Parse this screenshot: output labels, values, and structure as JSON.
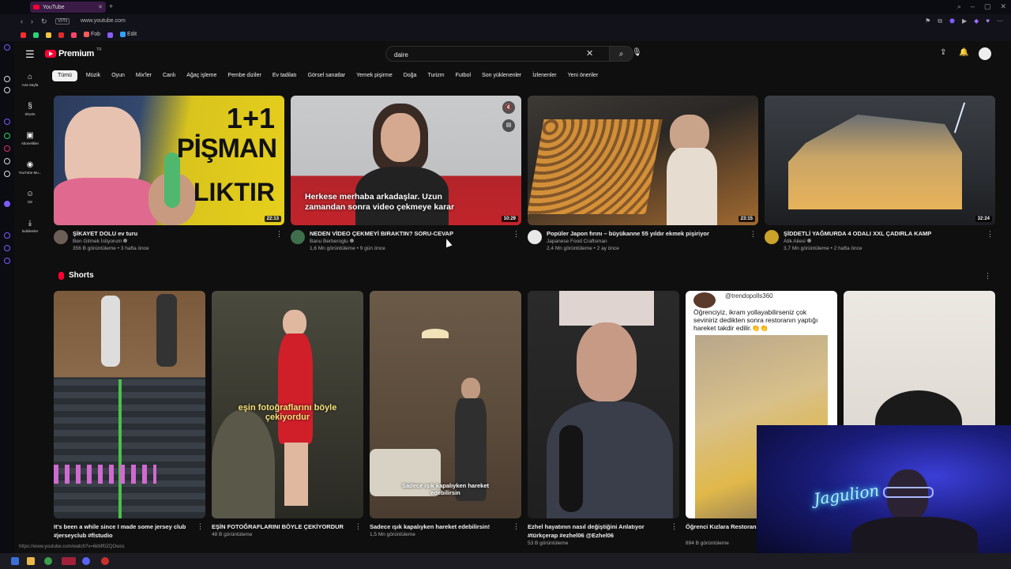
{
  "browser": {
    "tab_title": "YouTube",
    "url": "www.youtube.com",
    "vpn_label": "VPN",
    "bookmarks": [
      {
        "label": "Fob",
        "color": "#ff5a5a"
      },
      {
        "label": "Edit",
        "color": "#33a1ff"
      }
    ]
  },
  "header": {
    "logo_text": "Premium",
    "logo_region": "TR",
    "search_value": "daire"
  },
  "chips": [
    "Tümü",
    "Müzik",
    "Oyun",
    "Mix'ler",
    "Canlı",
    "Ağaç işleme",
    "Pembe diziler",
    "Ev tadilatı",
    "Görsel sanatlar",
    "Yemek pişirme",
    "Doğa",
    "Turizm",
    "Futbol",
    "Son yüklenenler",
    "İzlenenler",
    "Yeni öneriler"
  ],
  "guide": [
    {
      "label": "Ana Sayfa",
      "icon": "home-icon"
    },
    {
      "label": "Shorts",
      "icon": "shorts-icon"
    },
    {
      "label": "Abonelikler",
      "icon": "subscriptions-icon"
    },
    {
      "label": "YouTube Mu...",
      "icon": "youtube-music-icon"
    },
    {
      "label": "Siz",
      "icon": "you-icon"
    },
    {
      "label": "İndirilenler",
      "icon": "download-icon"
    }
  ],
  "videos": [
    {
      "title": "ŞİKAYET DOLU ev turu",
      "channel": "Ben Gitmek İstiyorum",
      "stats": "356 B görüntüleme • 3 hafta önce",
      "duration": "22:13",
      "thumb_text_a": "1+1",
      "thumb_text_b": "PİŞMAN",
      "thumb_text_c": "LIKTIR"
    },
    {
      "title": "NEDEN VİDEO ÇEKMEYİ BIRAKTIN? SORU-CEVAP",
      "channel": "Banu Berberoglu",
      "stats": "1,6 Mn görüntüleme • 9 gün önce",
      "duration": "10:29",
      "caption": "Herkese merhaba arkadaşlar. Uzun zamandan sonra video çekmeye karar"
    },
    {
      "title": "Popüler Japon fırını – büyükanne 55 yıldır ekmek pişiriyor",
      "channel": "Japanese Food Craftsman",
      "stats": "2,4 Mn görüntüleme • 2 ay önce",
      "duration": "23:15"
    },
    {
      "title": "ŞİDDETLİ YAĞMURDA 4 ODALI XXL ÇADIRLA KAMP",
      "channel": "Atik Ailesi",
      "stats": "3,7 Mn görüntüleme • 2 hafta önce",
      "duration": "32:24"
    }
  ],
  "shorts": {
    "section_title": "Shorts",
    "items": [
      {
        "title": "It's been a while since I made some jersey club #jerseyclub #flstudio",
        "views": ""
      },
      {
        "title": "EŞİN FOTOĞRAFLARINI BÖYLE ÇEKİYORDUR",
        "views": "48 B görüntüleme",
        "caption": "eşin fotoğraflarını böyle çekiyordur"
      },
      {
        "title": "Sadece ışık kapalıyken hareket edebilirsin!",
        "views": "1,5 Mn görüntüleme",
        "caption": "Sadece ışık kapalıyken hareket edebilirsin"
      },
      {
        "title": "Ezhel hayatının nasıl değiştiğini Anlatıyor #türkçerap #ezhel06 @Ezhel06",
        "views": "53 B görüntüleme"
      },
      {
        "title": "Öğrenci Kızlara Restoran Hareket👏👏",
        "views": "894 B görüntüleme",
        "handle": "@trendopolls360",
        "caption": "Öğrenciyiz, ikram yollayabilirseniz çok seviniriz dedikten sonra restoranın yaptığı hareket takdir edilir.👏👏"
      },
      {
        "title": "",
        "views": ""
      }
    ]
  },
  "webcam": {
    "neon_text": "Jagulion"
  },
  "status_url": "https://www.youtube.com/watch?v=6kMf0ZQOwss"
}
